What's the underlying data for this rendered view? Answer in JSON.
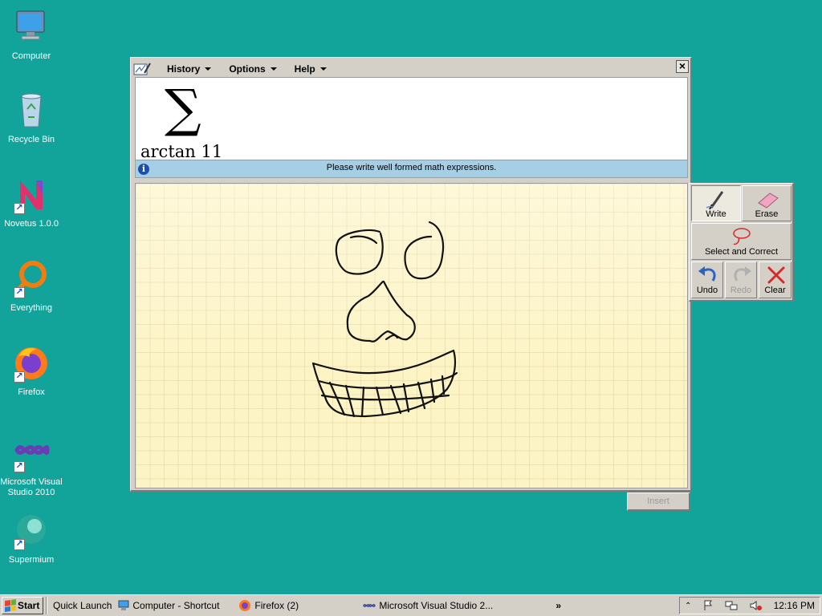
{
  "desktop": {
    "icons": [
      {
        "label": "Computer",
        "shortcut": false
      },
      {
        "label": "Recycle Bin",
        "shortcut": false
      },
      {
        "label": "Novetus 1.0.0",
        "shortcut": true
      },
      {
        "label": "Everything",
        "shortcut": true
      },
      {
        "label": "Firefox",
        "shortcut": true
      },
      {
        "label": "Microsoft Visual Studio 2010",
        "shortcut": true
      },
      {
        "label": "Supermium",
        "shortcut": true
      }
    ]
  },
  "math_input": {
    "menu": {
      "history": "History",
      "options": "Options",
      "help": "Help"
    },
    "close_label": "×",
    "preview": {
      "symbol": "∑",
      "expression": "arctan 11"
    },
    "info_message": "Please write well formed math expressions.",
    "tools": {
      "write": "Write",
      "erase": "Erase",
      "select_correct": "Select and Correct",
      "undo": "Undo",
      "redo": "Redo",
      "clear": "Clear"
    },
    "insert_label": "Insert"
  },
  "taskbar": {
    "start": "Start",
    "quick_launch": "Quick Launch",
    "items": [
      "Computer - Shortcut",
      "Firefox (2)",
      "Microsoft Visual Studio 2..."
    ],
    "overflow": "»",
    "clock": "12:16 PM"
  },
  "colors": {
    "desktop": "#12a39a",
    "canvas": "#fdf4c6",
    "infobar": "#a6cfe6"
  }
}
